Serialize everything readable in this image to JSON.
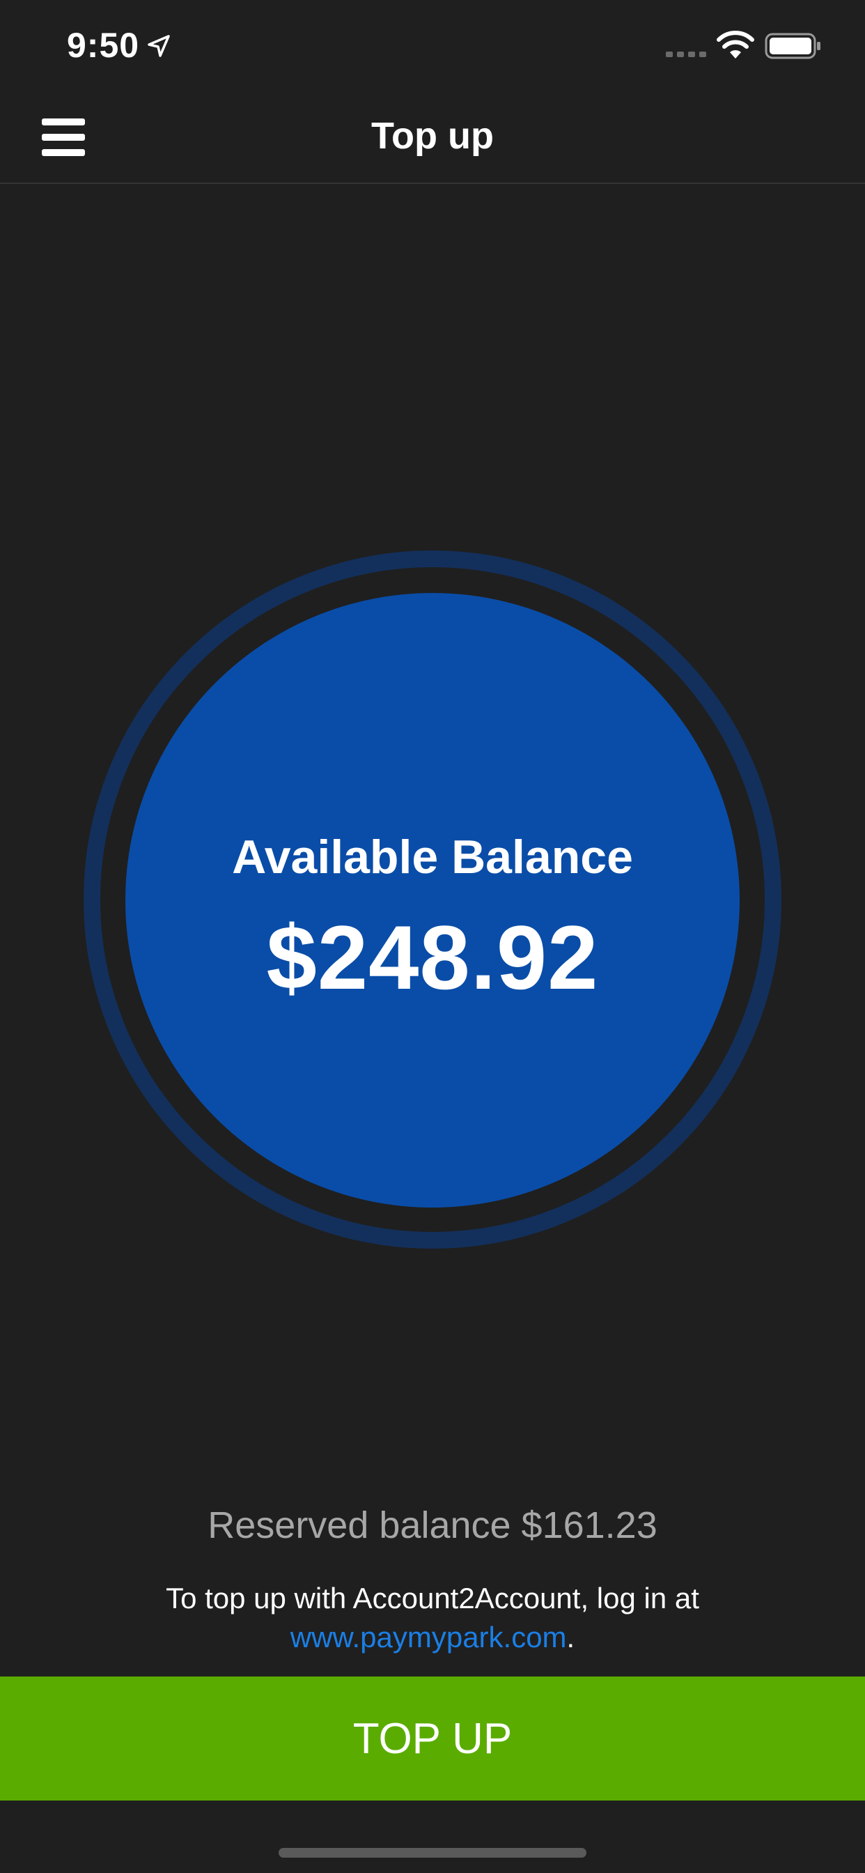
{
  "status_bar": {
    "time": "9:50",
    "icons": [
      "location-arrow-icon",
      "cellular-signal-icon",
      "wifi-icon",
      "battery-icon"
    ]
  },
  "nav": {
    "title": "Top up",
    "menu_icon": "hamburger-menu-icon"
  },
  "balance": {
    "label": "Available Balance",
    "amount": "$248.92"
  },
  "reserved": {
    "text": "Reserved balance $161.23"
  },
  "topup_info": {
    "prefix": "To top up with Account2Account, log in at",
    "link_text": "www.paymypark.com",
    "suffix": "."
  },
  "button": {
    "label": "TOP UP"
  },
  "colors": {
    "background": "#1f1f1f",
    "circle": "#0a4da8",
    "ring": "#13305c",
    "link": "#1a7fe6",
    "button": "#5aac00",
    "reserved_text": "#a7a7a7"
  }
}
